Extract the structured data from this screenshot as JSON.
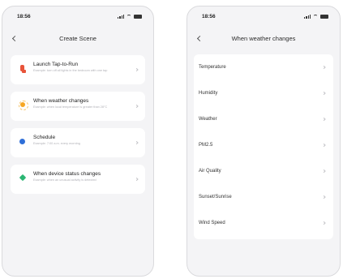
{
  "left_screen": {
    "status_time": "18:56",
    "title": "Create Scene",
    "cards": [
      {
        "icon": "tap-to-run-icon",
        "title": "Launch Tap-to-Run",
        "subtitle": "Example: turn off all lights in the bedroom with one tap"
      },
      {
        "icon": "weather-icon",
        "title": "When weather changes",
        "subtitle": "Example: when local temperature is greater than 28°C"
      },
      {
        "icon": "schedule-icon",
        "title": "Schedule",
        "subtitle": "Example: 7:00 a.m. every morning"
      },
      {
        "icon": "device-status-icon",
        "title": "When device status changes",
        "subtitle": "Example: when an unusual activity is detected"
      }
    ]
  },
  "right_screen": {
    "status_time": "18:56",
    "title": "When weather changes",
    "items": [
      "Temperature",
      "Humidity",
      "Weather",
      "PM2.5",
      "Air Quality",
      "Sunset/Sunrise",
      "Wind Speed"
    ]
  }
}
